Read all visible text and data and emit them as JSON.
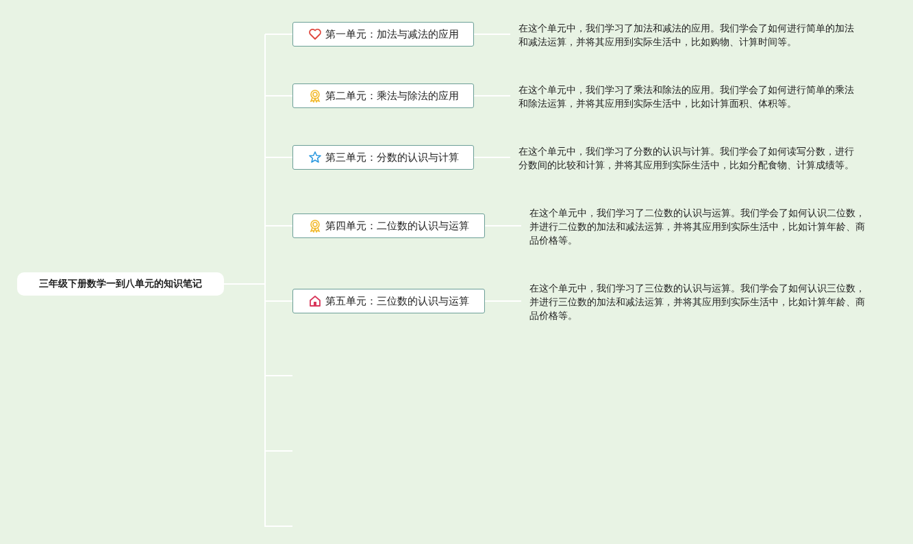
{
  "root": {
    "title": "三年级下册数学一到八单元的知识笔记"
  },
  "units": [
    {
      "kind": "heart",
      "title": "第一单元：加法与减法的应用",
      "note": "在这个单元中，我们学习了加法和减法的应用。我们学会了如何进行简单的加法和减法运算，并将其应用到实际生活中，比如购物、计算时间等。"
    },
    {
      "kind": "medal",
      "title": "第二单元：乘法与除法的应用",
      "note": "在这个单元中，我们学习了乘法和除法的应用。我们学会了如何进行简单的乘法和除法运算，并将其应用到实际生活中，比如计算面积、体积等。"
    },
    {
      "kind": "star",
      "title": "第三单元：分数的认识与计算",
      "note": "在这个单元中，我们学习了分数的认识与计算。我们学会了如何读写分数，进行分数间的比较和计算，并将其应用到实际生活中，比如分配食物、计算成绩等。"
    },
    {
      "kind": "medal",
      "title": "第四单元：二位数的认识与运算",
      "note": "在这个单元中，我们学习了二位数的认识与运算。我们学会了如何认识二位数，并进行二位数的加法和减法运算，并将其应用到实际生活中，比如计算年龄、商品价格等。"
    },
    {
      "kind": "house",
      "title": "第五单元：三位数的认识与运算",
      "note": "在这个单元中，我们学习了三位数的认识与运算。我们学会了如何认识三位数，并进行三位数的加法和减法运算，并将其应用到实际生活中，比如计算年龄、商品价格等。"
    }
  ]
}
